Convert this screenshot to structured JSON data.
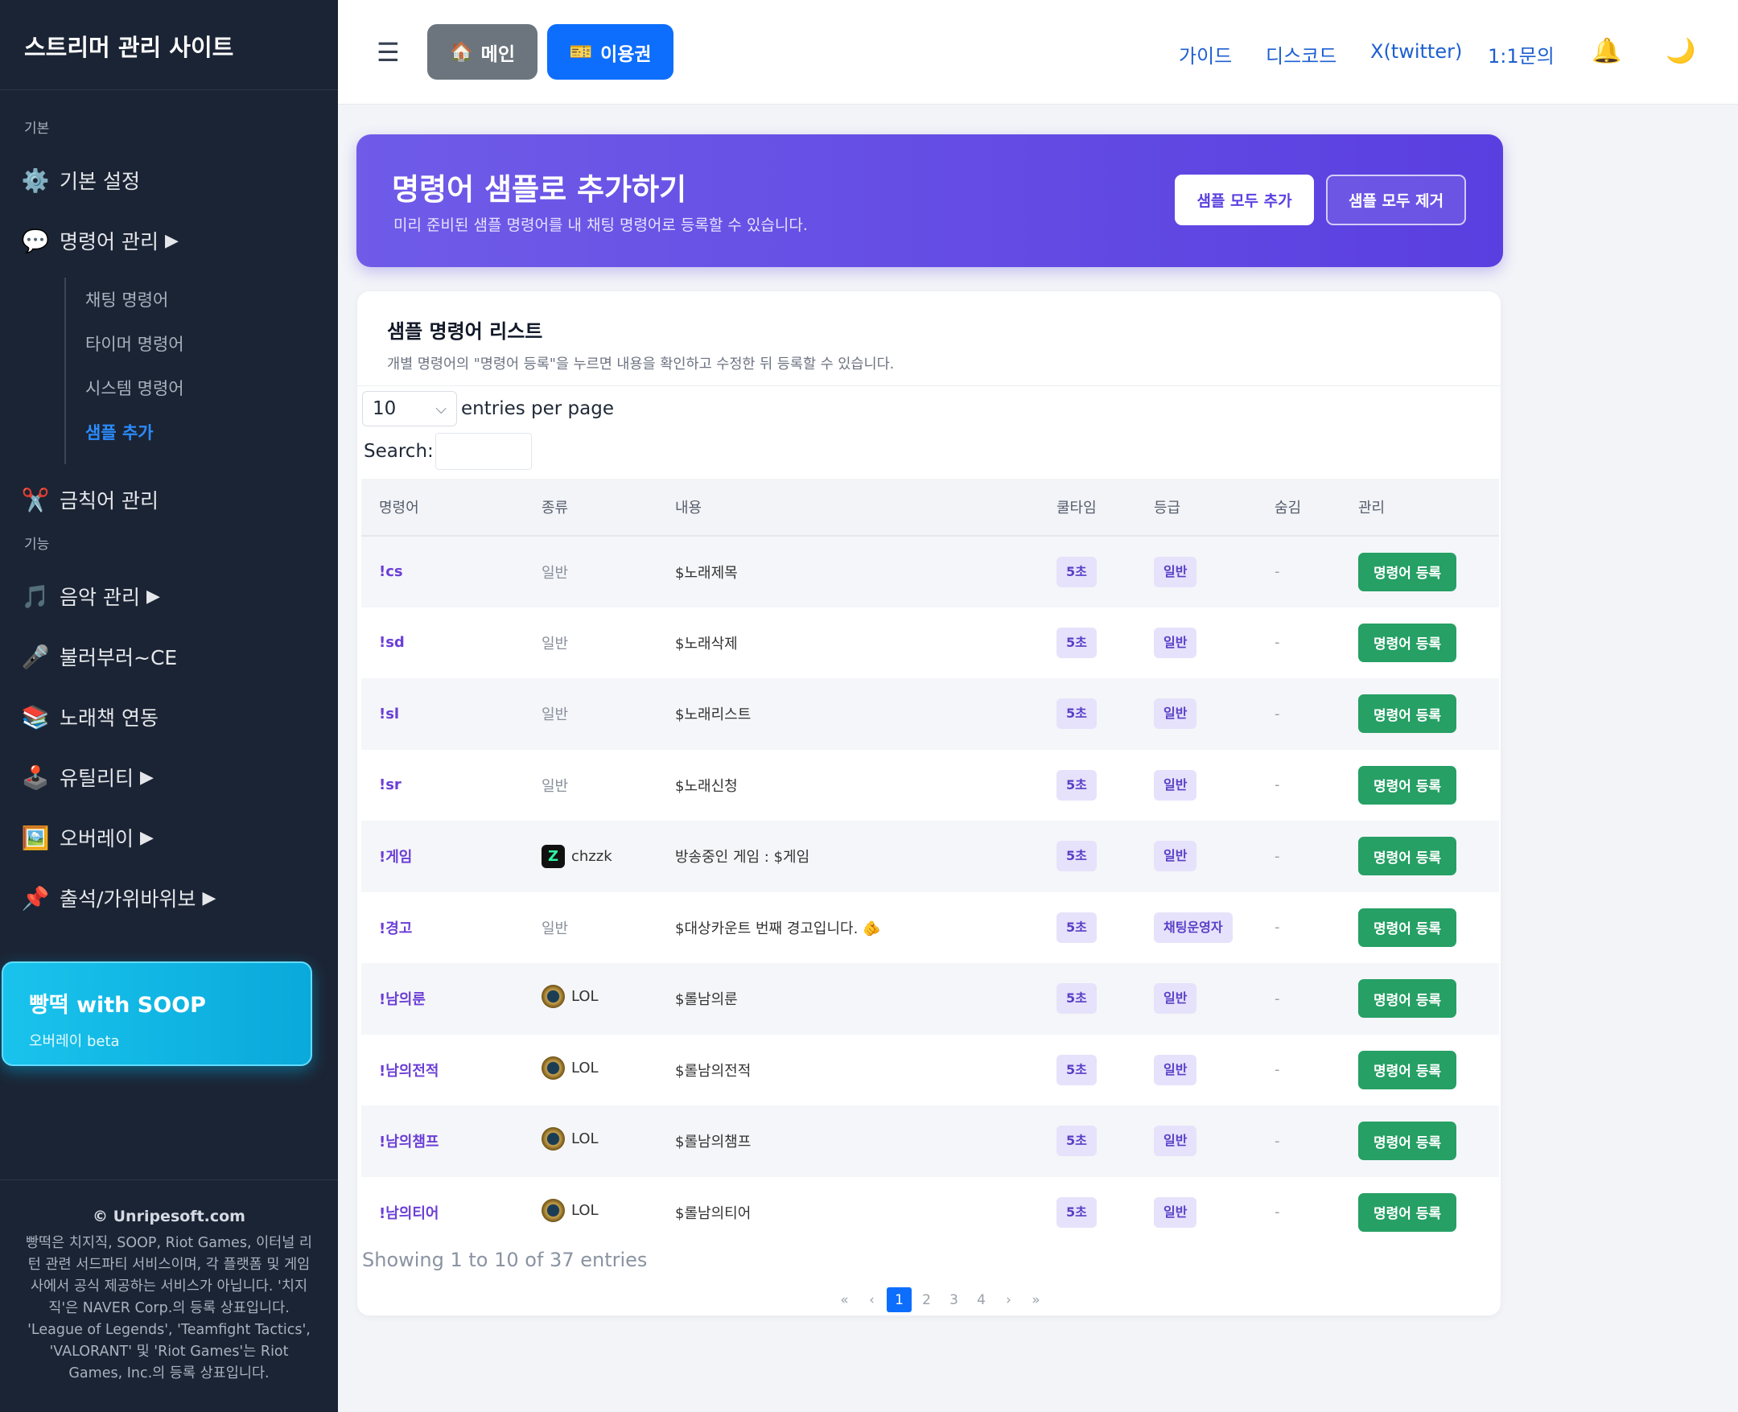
{
  "sidebar": {
    "brand": "스트리머 관리 사이트",
    "section_basic": "기본",
    "section_features": "기능",
    "basic_settings": "기본 설정",
    "command_mgmt": "명령어 관리",
    "sub_chat": "채팅 명령어",
    "sub_timer": "타이머 명령어",
    "sub_system": "시스템 명령어",
    "sub_sample": "샘플 추가",
    "banned_words": "금칙어 관리",
    "music": "음악 관리",
    "sing": "불러부러~CE",
    "songbook": "노래책 연동",
    "utility": "유틸리티",
    "overlay": "오버레이",
    "attendance": "출석/가위바위보",
    "arrow": "▶",
    "promo_title": "빵떡 with SOOP",
    "promo_sub": "오버레이 beta",
    "footer_copyright": "© Unripesoft.com",
    "footer_disclaimer": "빵떡은 치지직, SOOP, Riot Games, 이터널 리턴 관련 서드파티 서비스이며, 각 플랫폼 및 게임사에서 공식 제공하는 서비스가 아닙니다. '치지직'은 NAVER Corp.의 등록 상표입니다. 'League of Legends', 'Teamfight Tactics', 'VALORANT' 및 'Riot Games'는 Riot Games, Inc.의 등록 상표입니다."
  },
  "topbar": {
    "menu_icon": "☰",
    "main_label": "메인",
    "ticket_label": "이용권",
    "guide": "가이드",
    "discord": "디스코드",
    "twitter": "X(twitter)",
    "inquiry": "1:1문의"
  },
  "icons": {
    "gear": "⚙️",
    "chat": "💬",
    "scissors": "✂️",
    "music": "🎵",
    "mic": "🎤",
    "books": "📚",
    "joystick": "🕹️",
    "picture": "🖼️",
    "pin": "📌",
    "home": "🏠",
    "ticket": "🎫",
    "bell": "🔔",
    "moon": "🌙",
    "chevron": "⌵"
  },
  "hero": {
    "title": "명령어 샘플로 추가하기",
    "subtitle": "미리 준비된 샘플 명령어를 내 채팅 명령어로 등록할 수 있습니다.",
    "add_all": "샘플 모두 추가",
    "remove_all": "샘플 모두 제거"
  },
  "card": {
    "title": "샘플 명령어 리스트",
    "subtitle": "개별 명령어의 \"명령어 등록\"을 누르면 내용을 확인하고 수정한 뒤 등록할 수 있습니다.",
    "per_page_value": "10",
    "per_page_label": "entries per page",
    "search_label": "Search:",
    "showing": "Showing 1 to 10 of 37 entries"
  },
  "table": {
    "headers": [
      "명령어",
      "종류",
      "내용",
      "쿨타임",
      "등급",
      "숨김",
      "관리"
    ],
    "rows": [
      {
        "cmd": "!cs",
        "kind": "일반",
        "content": "$노래제목",
        "cool": "5초",
        "grade": "일반",
        "hidden": "-",
        "action": "명령어 등록"
      },
      {
        "cmd": "!sd",
        "kind": "일반",
        "content": "$노래삭제",
        "cool": "5초",
        "grade": "일반",
        "hidden": "-",
        "action": "명령어 등록"
      },
      {
        "cmd": "!sl",
        "kind": "일반",
        "content": "$노래리스트",
        "cool": "5초",
        "grade": "일반",
        "hidden": "-",
        "action": "명령어 등록"
      },
      {
        "cmd": "!sr",
        "kind": "일반",
        "content": "$노래신청",
        "cool": "5초",
        "grade": "일반",
        "hidden": "-",
        "action": "명령어 등록"
      },
      {
        "cmd": "!게임",
        "kind": "chzzk",
        "content": "방송중인 게임 : $게임",
        "cool": "5초",
        "grade": "일반",
        "hidden": "-",
        "action": "명령어 등록"
      },
      {
        "cmd": "!경고",
        "kind": "일반",
        "content": "$대상카운트 번째 경고입니다. 🫵",
        "cool": "5초",
        "grade": "채팅운영자",
        "hidden": "-",
        "action": "명령어 등록"
      },
      {
        "cmd": "!남의룬",
        "kind": "LOL",
        "content": "$롤남의룬",
        "cool": "5초",
        "grade": "일반",
        "hidden": "-",
        "action": "명령어 등록"
      },
      {
        "cmd": "!남의전적",
        "kind": "LOL",
        "content": "$롤남의전적",
        "cool": "5초",
        "grade": "일반",
        "hidden": "-",
        "action": "명령어 등록"
      },
      {
        "cmd": "!남의챔프",
        "kind": "LOL",
        "content": "$롤남의챔프",
        "cool": "5초",
        "grade": "일반",
        "hidden": "-",
        "action": "명령어 등록"
      },
      {
        "cmd": "!남의티어",
        "kind": "LOL",
        "content": "$롤남의티어",
        "cool": "5초",
        "grade": "일반",
        "hidden": "-",
        "action": "명령어 등록"
      }
    ]
  },
  "pagination": {
    "first": "«",
    "prev": "‹",
    "pages": [
      "1",
      "2",
      "3",
      "4"
    ],
    "current": "1",
    "next": "›",
    "last": "»"
  }
}
